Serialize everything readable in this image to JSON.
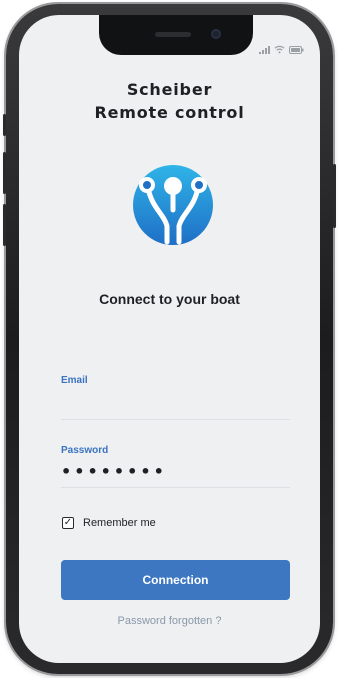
{
  "app": {
    "title_line1": "Scheiber",
    "title_line2": "Remote control",
    "subtitle": "Connect to your boat"
  },
  "form": {
    "email_label": "Email",
    "email_value": "",
    "password_label": "Password",
    "password_value": "••••••••",
    "remember_label": "Remember me",
    "remember_checked": true,
    "connect_label": "Connection",
    "forgot_label": "Password forgotten ?"
  },
  "icons": {
    "logo": "scheiber-logo",
    "checkbox": "check-icon",
    "signal": "signal-icon",
    "wifi": "wifi-icon",
    "battery": "battery-icon"
  },
  "colors": {
    "accent": "#3d77c2",
    "label": "#3a73c0",
    "link": "#8a98aa",
    "screen_bg": "#eef0f2"
  }
}
